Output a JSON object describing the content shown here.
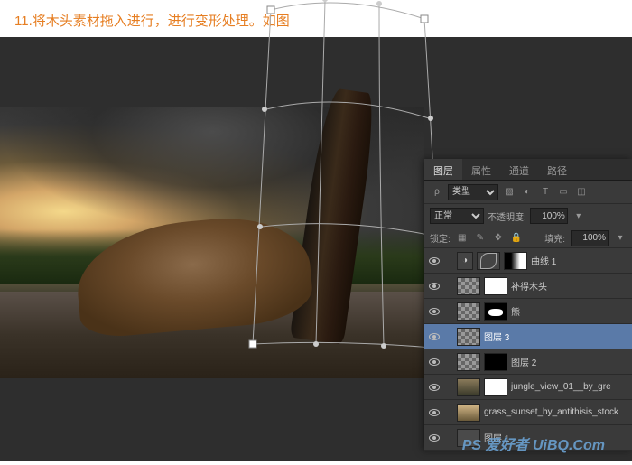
{
  "instruction": "11.将木头素材拖入进行，进行变形处理。如图",
  "panel": {
    "tabs": [
      "图层",
      "属性",
      "通道",
      "路径"
    ],
    "active_tab": 0,
    "filter_label": "类型",
    "blend_mode": "正常",
    "opacity_label": "不透明度:",
    "opacity_value": "100%",
    "lock_label": "锁定:",
    "fill_label": "填充:",
    "fill_value": "100%"
  },
  "layers": [
    {
      "name": "曲线 1",
      "type": "adjustment",
      "mask": "partial",
      "visible": true
    },
    {
      "name": "补得木头",
      "type": "image",
      "thumb": "checker",
      "mask": "white",
      "visible": true
    },
    {
      "name": "熊",
      "type": "image",
      "thumb": "checker",
      "mask": "shape",
      "visible": true
    },
    {
      "name": "图层 3",
      "type": "image",
      "thumb": "checker",
      "mask": "none",
      "visible": true,
      "selected": true
    },
    {
      "name": "图层 2",
      "type": "image",
      "thumb": "checker",
      "mask": "black",
      "visible": true
    },
    {
      "name": "jungle_view_01__by_gre",
      "type": "image",
      "thumb": "img1",
      "mask": "white",
      "visible": true
    },
    {
      "name": "grass_sunset_by_antithisis_stock",
      "type": "image",
      "thumb": "img2",
      "mask": "none",
      "visible": true
    },
    {
      "name": "图层 1",
      "type": "image",
      "thumb": "img3",
      "mask": "none",
      "visible": true
    }
  ],
  "watermark": "PS 爱好者 UiBQ.Com"
}
